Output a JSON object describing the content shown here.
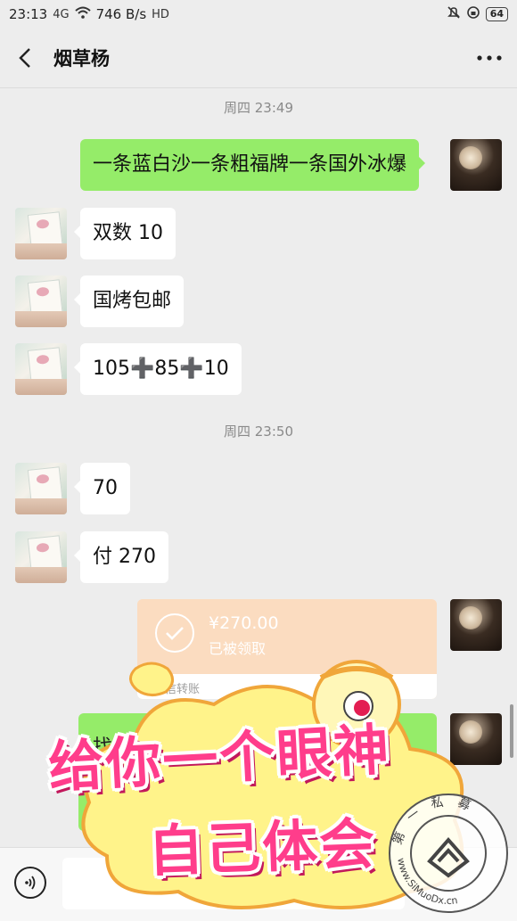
{
  "status_bar": {
    "time": "23:13",
    "signal": "4G",
    "network_speed": "746 B/s",
    "hd": "HD",
    "battery": "64"
  },
  "header": {
    "title": "烟草杨",
    "back_icon": "chevron-left-icon",
    "more_icon": "more-dots-icon"
  },
  "messages": {
    "time1": "周四 23:49",
    "msg1": "一条蓝白沙一条粗福牌一条国外冰爆",
    "msg2": "双数 10",
    "msg3": "国烤包邮",
    "msg4": "105➕85➕10",
    "time2": "周四 23:50",
    "msg5": "70",
    "msg6": "付 270",
    "partial": "找"
  },
  "transfer": {
    "amount": "¥270.00",
    "status": "已被领取",
    "label": "微信转账"
  },
  "sticker": {
    "line1": "给你一个眼神",
    "line2": "自己体会"
  },
  "watermark": {
    "text_top": "第一私募",
    "text_bottom": "www.SiMuoDx.cn"
  },
  "input_bar": {
    "voice_icon": "voice-icon",
    "placeholder": ""
  },
  "colors": {
    "background": "#ededed",
    "outgoing_bubble": "#95ec69",
    "incoming_bubble": "#ffffff",
    "transfer_card": "#fbdcc0",
    "sticker_pink": "#ff3d8b",
    "sticker_yellow": "#fff38a"
  }
}
